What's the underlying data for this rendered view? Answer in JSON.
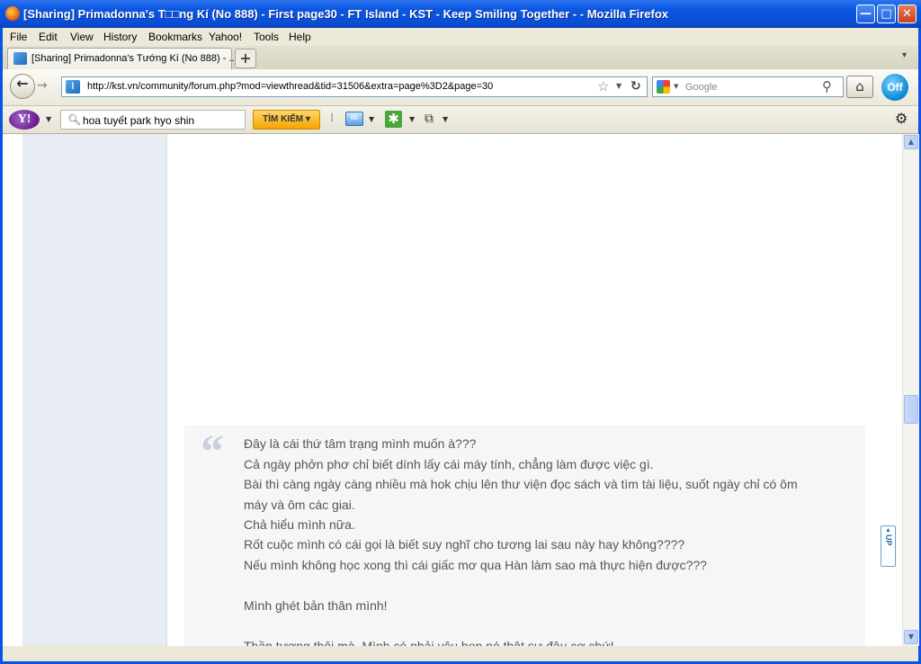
{
  "window": {
    "title": "[Sharing] Primadonna's T□□ng Kí (No 888) - First page30 - FT Island - KST - Keep Smiling Together - - Mozilla Firefox",
    "minimize": "—",
    "maximize": "□",
    "close": "✕"
  },
  "menu": [
    "File",
    "Edit",
    "View",
    "History",
    "Bookmarks",
    "Yahoo!",
    "Tools",
    "Help"
  ],
  "tab": {
    "label": "[Sharing] Primadonna's Tướng Kí (No 888) - ...",
    "new_tab": "+",
    "list_tabs": "▾"
  },
  "nav": {
    "back": "←",
    "forward": "→",
    "url": "http://kst.vn/community/forum.php?mod=viewthread&tid=31506&extra=page%3D2&page=30",
    "search_placeholder": "Google",
    "home": "⌂",
    "skype": "Off"
  },
  "yahoo": {
    "logo": "Y!",
    "search_value": "hoa tuyết park hyo shin",
    "search_button": "TÌM KIẾM ▾"
  },
  "icons": [
    "window-icon",
    "star-icon",
    "reload-icon",
    "search-icon",
    "home-icon",
    "skype-icon",
    "mail-icon",
    "gear-icon",
    "page-icon"
  ],
  "post": {
    "lines": [
      "Đây là cái thứ tâm trạng mình muốn à???",
      "Cả ngày phởn phơ chỉ biết dính lấy cái máy tính, chẳng làm được việc gì.",
      "Bài thì càng ngày càng nhiều mà hok chịu lên thư viện đọc sách và tìm tài liệu, suốt ngày chỉ có ôm",
      "máy và ôm các giai.",
      "Chả hiểu mình nữa.",
      "Rốt cuộc mình có cái gọi là biết suy nghĩ cho tương lai sau này hay không????",
      "Nếu mình không học xong thì cái giấc mơ qua Hàn làm sao mà thực hiện được???",
      "",
      "Mình ghét bản thân mình!",
      "",
      "Thần tượng thôi mà. Mình có phải yêu bọn nó thật sự đâu cơ chứ!"
    ],
    "up_button": "UP"
  }
}
